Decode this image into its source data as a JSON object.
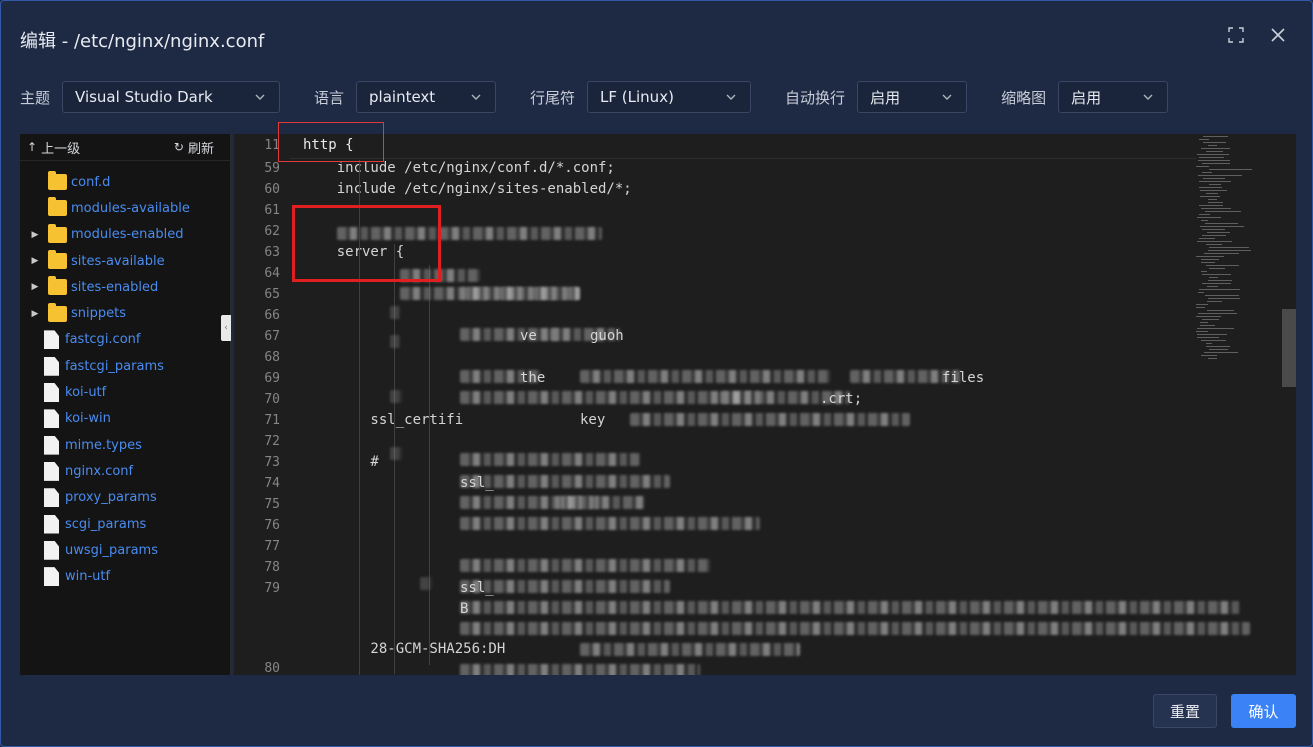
{
  "dialog": {
    "title": "编辑 - /etc/nginx/nginx.conf",
    "fullscreen_icon": "fullscreen-icon",
    "close_icon": "close-icon"
  },
  "toolbar": {
    "theme_label": "主题",
    "theme_value": "Visual Studio Dark",
    "language_label": "语言",
    "language_value": "plaintext",
    "eol_label": "行尾符",
    "eol_value": "LF (Linux)",
    "wrap_label": "自动换行",
    "wrap_value": "启用",
    "minimap_label": "缩略图",
    "minimap_value": "启用"
  },
  "files": {
    "up_label": "上一级",
    "refresh_label": "刷新",
    "items": [
      {
        "name": "conf.d",
        "type": "folder",
        "expandable": false
      },
      {
        "name": "modules-available",
        "type": "folder",
        "expandable": false
      },
      {
        "name": "modules-enabled",
        "type": "folder",
        "expandable": true
      },
      {
        "name": "sites-available",
        "type": "folder",
        "expandable": true
      },
      {
        "name": "sites-enabled",
        "type": "folder",
        "expandable": true
      },
      {
        "name": "snippets",
        "type": "folder",
        "expandable": true
      },
      {
        "name": "fastcgi.conf",
        "type": "file"
      },
      {
        "name": "fastcgi_params",
        "type": "file"
      },
      {
        "name": "koi-utf",
        "type": "file"
      },
      {
        "name": "koi-win",
        "type": "file"
      },
      {
        "name": "mime.types",
        "type": "file"
      },
      {
        "name": "nginx.conf",
        "type": "file"
      },
      {
        "name": "proxy_params",
        "type": "file"
      },
      {
        "name": "scgi_params",
        "type": "file"
      },
      {
        "name": "uwsgi_params",
        "type": "file"
      },
      {
        "name": "win-utf",
        "type": "file"
      }
    ]
  },
  "editor": {
    "sticky": {
      "ln": "11",
      "text": "http {"
    },
    "lines": [
      {
        "ln": "59",
        "text": "    include /etc/nginx/conf.d/*.conf;"
      },
      {
        "ln": "60",
        "text": "    include /etc/nginx/sites-enabled/*;"
      },
      {
        "ln": "61",
        "text": ""
      },
      {
        "ln": "62",
        "text": ""
      },
      {
        "ln": "63",
        "text": "    server {"
      },
      {
        "ln": "64",
        "text": ""
      },
      {
        "ln": "65",
        "text": ""
      },
      {
        "ln": "66",
        "text": ""
      },
      {
        "ln": "67",
        "text": ""
      },
      {
        "ln": "68",
        "text": ""
      },
      {
        "ln": "69",
        "text": ""
      },
      {
        "ln": "70",
        "text": ""
      },
      {
        "ln": "71",
        "text": "        ssl_certifi"
      },
      {
        "ln": "72",
        "text": ""
      },
      {
        "ln": "73",
        "text": "        #"
      },
      {
        "ln": "74",
        "text": ""
      },
      {
        "ln": "75",
        "text": ""
      },
      {
        "ln": "76",
        "text": ""
      },
      {
        "ln": "77",
        "text": ""
      },
      {
        "ln": "78",
        "text": ""
      },
      {
        "ln": "79",
        "text": ""
      },
      {
        "ln": "",
        "text": ""
      },
      {
        "ln": "",
        "text": ""
      },
      {
        "ln": "",
        "text": "        28-GCM-SHA256:DH"
      },
      {
        "ln": "80",
        "text": ""
      }
    ],
    "fragments": {
      "l67": "ve",
      "l67b": "guoh",
      "l69": "the",
      "l69b": "files",
      "l70": ".crt;",
      "l71b": "key",
      "l74": "ssl_",
      "l79": "ssl_",
      "l80": "B"
    }
  },
  "footer": {
    "reset_label": "重置",
    "ok_label": "确认"
  }
}
